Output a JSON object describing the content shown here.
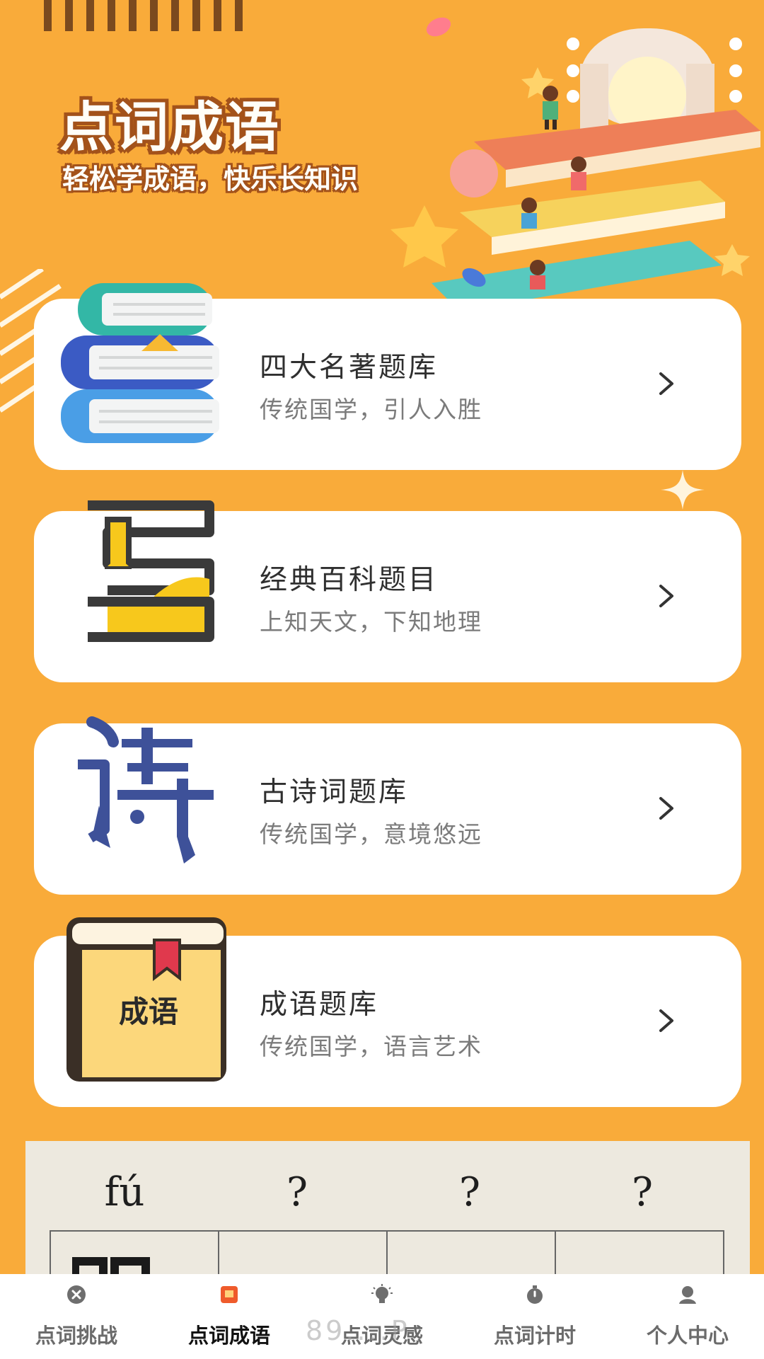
{
  "hero": {
    "title": "点词成语",
    "subtitle": "轻松学成语，快乐长知识"
  },
  "cards": [
    {
      "title": "四大名著题库",
      "subtitle": "传统国学，引人入胜",
      "icon": "books-stack-icon"
    },
    {
      "title": "经典百科题目",
      "subtitle": "上知天文，下知地理",
      "icon": "open-book-icon"
    },
    {
      "title": "古诗词题库",
      "subtitle": "传统国学，意境悠远",
      "icon": "poem-character-icon"
    },
    {
      "title": "成语题库",
      "subtitle": "传统国学，语言艺术",
      "icon": "idiom-book-icon",
      "icon_text": "成语"
    }
  ],
  "chevron": ">",
  "puzzle": {
    "pinyin": [
      "fú",
      "?",
      "?",
      "?"
    ]
  },
  "tabbar": {
    "active_index": 1,
    "items": [
      {
        "label": "点词挑战",
        "icon": "close-circle-icon"
      },
      {
        "label": "点词成语",
        "icon": "book-icon"
      },
      {
        "label": "点词灵感",
        "icon": "lightbulb-icon"
      },
      {
        "label": "点词计时",
        "icon": "stopwatch-icon"
      },
      {
        "label": "个人中心",
        "icon": "user-icon"
      }
    ]
  },
  "watermark": "89....P",
  "colors": {
    "background": "#f9ab3a",
    "card": "#ffffff",
    "title_stroke": "#a3521a"
  }
}
